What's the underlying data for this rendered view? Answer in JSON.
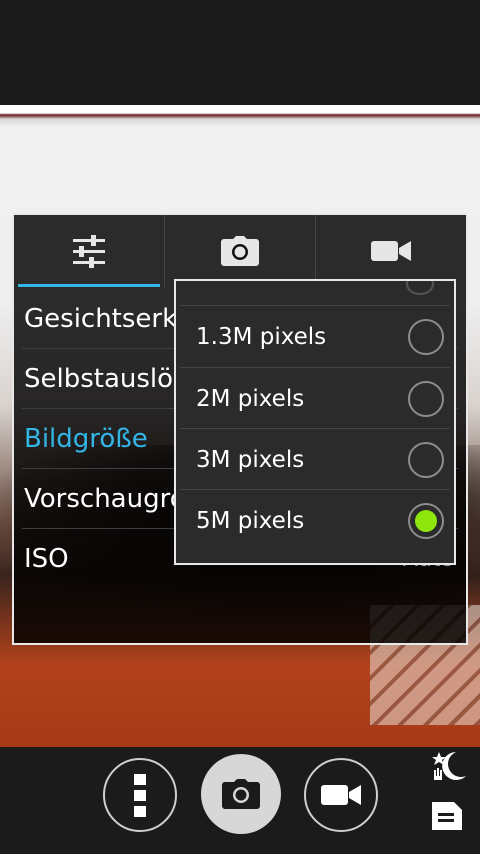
{
  "tabs": [
    {
      "name": "general-settings",
      "icon": "sliders-icon"
    },
    {
      "name": "photo-settings",
      "icon": "camera-icon"
    },
    {
      "name": "video-settings",
      "icon": "video-camera-icon"
    }
  ],
  "settings": [
    {
      "label": "Gesichtserkennung",
      "value": ""
    },
    {
      "label": "Selbstauslöser",
      "value": ""
    },
    {
      "label": "Bildgröße",
      "value": ""
    },
    {
      "label": "Vorschaugröße",
      "value": ""
    },
    {
      "label": "ISO",
      "value": "Auto"
    }
  ],
  "popup": {
    "options": [
      {
        "label": "1.3M pixels",
        "selected": false
      },
      {
        "label": "2M pixels",
        "selected": false
      },
      {
        "label": "3M pixels",
        "selected": false
      },
      {
        "label": "5M pixels",
        "selected": true
      }
    ]
  },
  "colors": {
    "accent": "#33b5e5",
    "radio_selected": "#8fe60e"
  },
  "controls": {
    "menu_icon": "overflow-menu-icon",
    "shutter_icon": "camera-icon",
    "video_icon": "video-camera-icon",
    "night_icon": "night-mode-icon",
    "gallery_icon": "document-icon"
  }
}
